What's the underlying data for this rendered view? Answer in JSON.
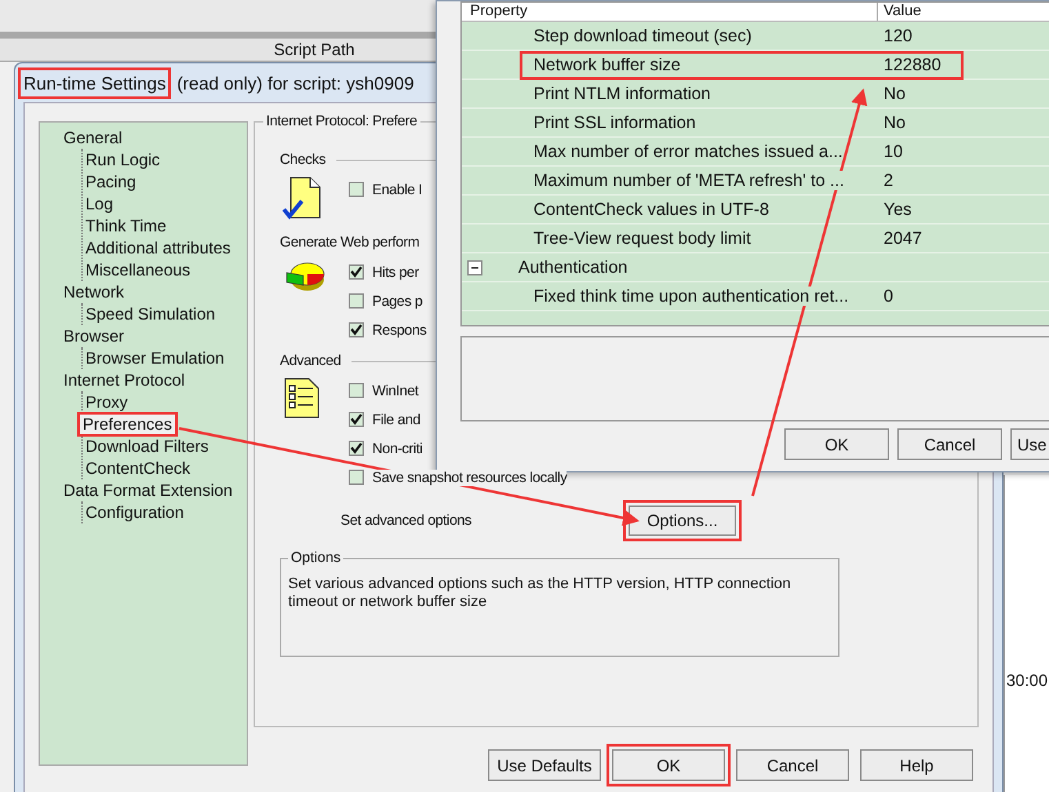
{
  "background_app": {
    "column_header": "Script Path",
    "time_label": "30:00"
  },
  "dialog": {
    "title": [
      {
        "text": "Run-time Settings",
        "highlighted": true
      },
      {
        "text": "(read only) for script: ysh0909",
        "highlighted": false
      }
    ],
    "tree": [
      {
        "label": "General",
        "selected": false,
        "children": [
          {
            "label": "Run Logic",
            "selected": false
          },
          {
            "label": "Pacing",
            "selected": false
          },
          {
            "label": "Log",
            "selected": false
          },
          {
            "label": "Think Time",
            "selected": false
          },
          {
            "label": "Additional attributes",
            "selected": false
          },
          {
            "label": "Miscellaneous",
            "selected": false
          }
        ]
      },
      {
        "label": "Network",
        "selected": false,
        "children": [
          {
            "label": "Speed Simulation",
            "selected": false
          }
        ]
      },
      {
        "label": "Browser",
        "selected": false,
        "children": [
          {
            "label": "Browser Emulation",
            "selected": false
          }
        ]
      },
      {
        "label": "Internet Protocol",
        "selected": false,
        "children": [
          {
            "label": "Proxy",
            "selected": false
          },
          {
            "label": "Preferences",
            "selected": true,
            "highlighted": true
          },
          {
            "label": "Download Filters",
            "selected": false
          },
          {
            "label": "ContentCheck",
            "selected": false
          }
        ]
      },
      {
        "label": "Data Format Extension",
        "selected": false,
        "children": [
          {
            "label": "Configuration",
            "selected": false
          }
        ]
      }
    ],
    "group_title": "Internet Protocol: Prefere",
    "sections": [
      {
        "title": "Checks",
        "kind": "ruled",
        "options": [
          {
            "label": "Enable I",
            "checked": false
          }
        ]
      },
      {
        "title": "Generate Web perform",
        "kind": "plain",
        "options": [
          {
            "label": "Hits per",
            "checked": true
          },
          {
            "label": "Pages p",
            "checked": false
          },
          {
            "label": "Respons",
            "checked": true
          }
        ]
      },
      {
        "title": "Advanced",
        "kind": "ruled",
        "options": [
          {
            "label": "WinInet",
            "checked": false
          },
          {
            "label": "File and",
            "checked": true
          },
          {
            "label": "Non-criti",
            "checked": true
          },
          {
            "label": "Save snapshot resources locally",
            "checked": false
          }
        ]
      }
    ],
    "advanced_label": "Set advanced options",
    "options_button": {
      "label": "Options...",
      "highlighted": true
    },
    "options_box": {
      "title": "Options",
      "text": "Set various advanced options such as the HTTP version, HTTP connection timeout or network buffer size"
    },
    "buttons": [
      {
        "label": "Use Defaults",
        "highlighted": false
      },
      {
        "label": "OK",
        "highlighted": true
      },
      {
        "label": "Cancel",
        "highlighted": false
      },
      {
        "label": "Help",
        "highlighted": false
      }
    ]
  },
  "property_window": {
    "columns": [
      "Property",
      "Value"
    ],
    "rows": [
      {
        "kind": "item",
        "property": "Step download timeout (sec)",
        "value": "120",
        "highlighted": false
      },
      {
        "kind": "item",
        "property": "Network buffer size",
        "value": "122880",
        "highlighted": true
      },
      {
        "kind": "item",
        "property": "Print NTLM information",
        "value": "No",
        "highlighted": false
      },
      {
        "kind": "item",
        "property": "Print SSL information",
        "value": "No",
        "highlighted": false
      },
      {
        "kind": "item",
        "property": "Max number of error matches issued a...",
        "value": "10",
        "highlighted": false
      },
      {
        "kind": "item",
        "property": "Maximum number of 'META refresh' to ...",
        "value": "2",
        "highlighted": false
      },
      {
        "kind": "item",
        "property": "ContentCheck values in UTF-8",
        "value": "Yes",
        "highlighted": false
      },
      {
        "kind": "item",
        "property": "Tree-View request body limit",
        "value": "2047",
        "highlighted": false
      },
      {
        "kind": "category",
        "property": "Authentication",
        "expanded": true
      },
      {
        "kind": "item",
        "property": "Fixed think time upon authentication ret...",
        "value": "0",
        "highlighted": false
      }
    ],
    "buttons": [
      "OK",
      "Cancel",
      "Use"
    ]
  }
}
